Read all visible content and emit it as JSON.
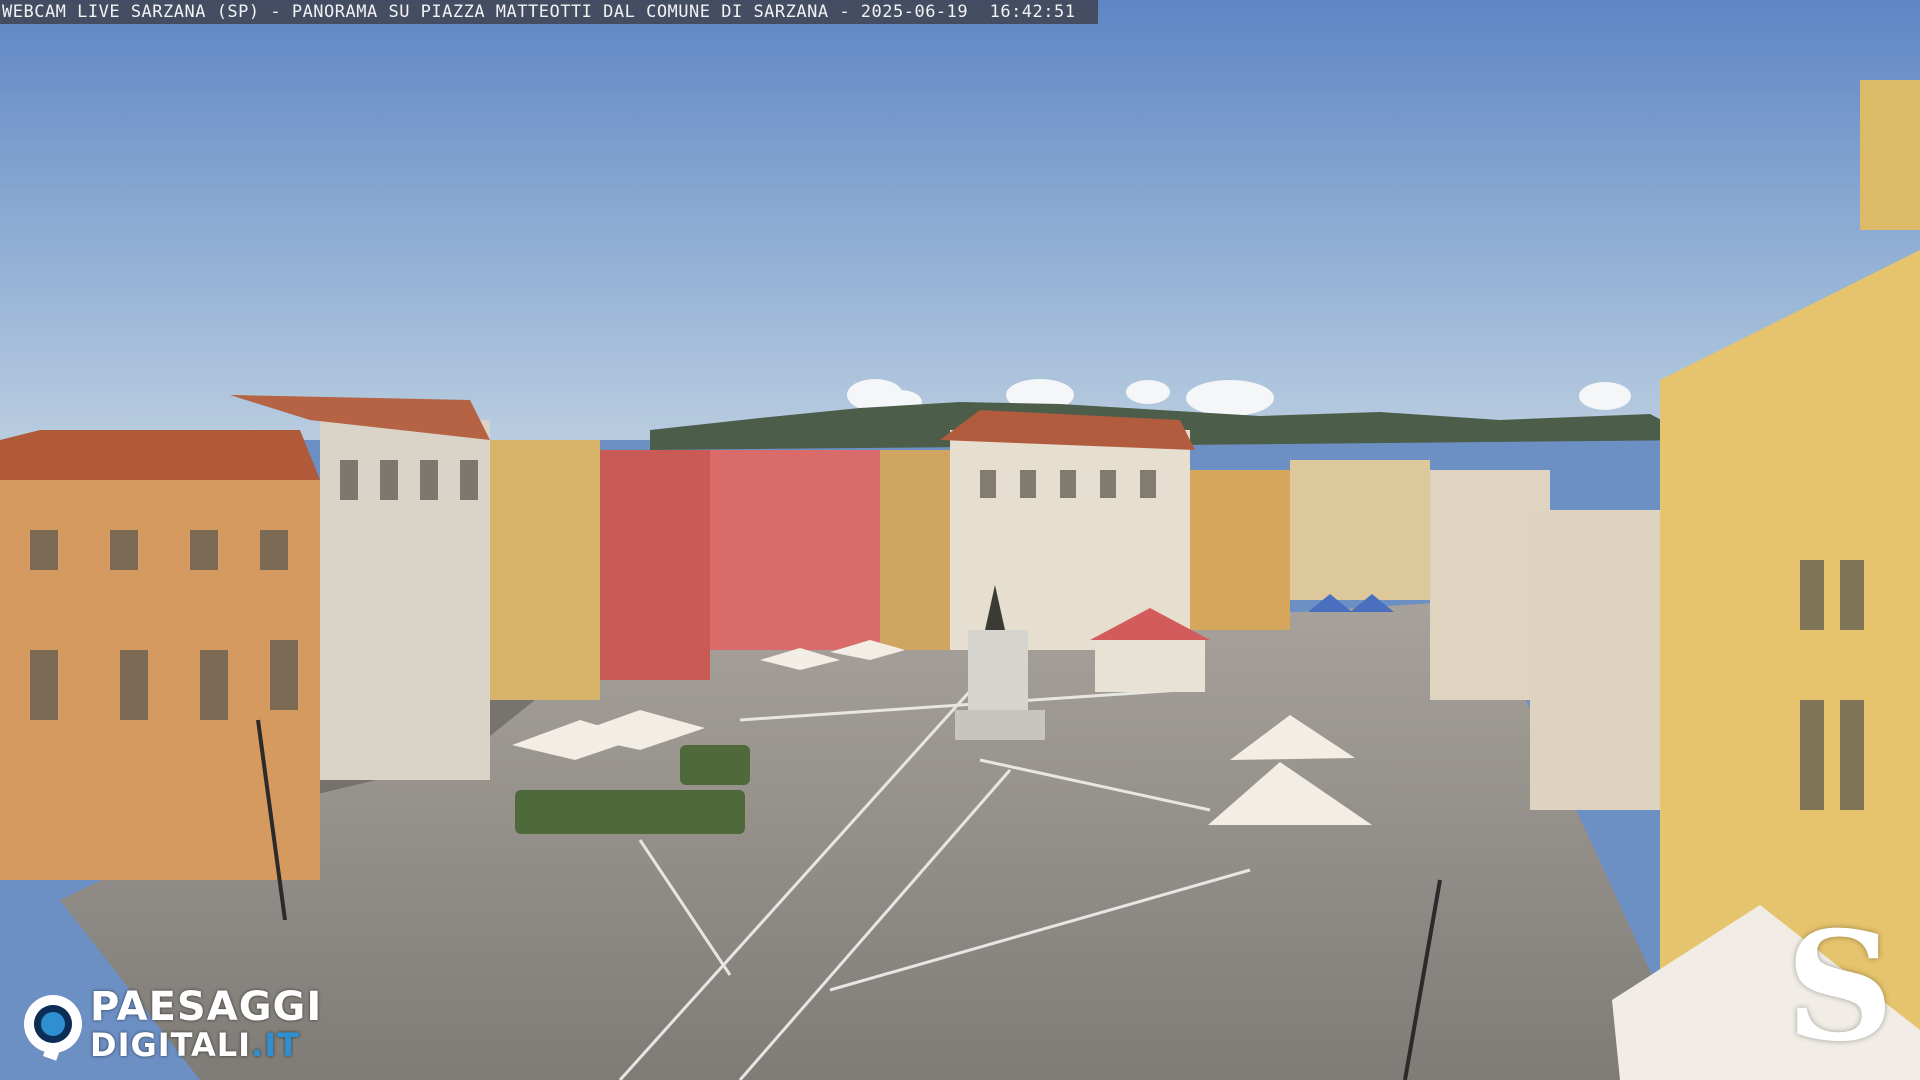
{
  "overlay": {
    "caption": "WEBCAM LIVE SARZANA (SP) - PANORAMA SU PIAZZA MATTEOTTI DAL COMUNE DI SARZANA - 2025-06-19  16:42:51"
  },
  "branding": {
    "logo_line1": "PAESAGGI",
    "logo_line2_main": "DIGITALI",
    "logo_line2_tld": ".IT",
    "logo_icon": "eye-icon",
    "corner_mark": "S"
  },
  "colors": {
    "sky_top": "#5e86c4",
    "sky_bottom": "#b9cde0",
    "pavement": "#8f8b86",
    "accent_blue": "#2f8fd0"
  }
}
